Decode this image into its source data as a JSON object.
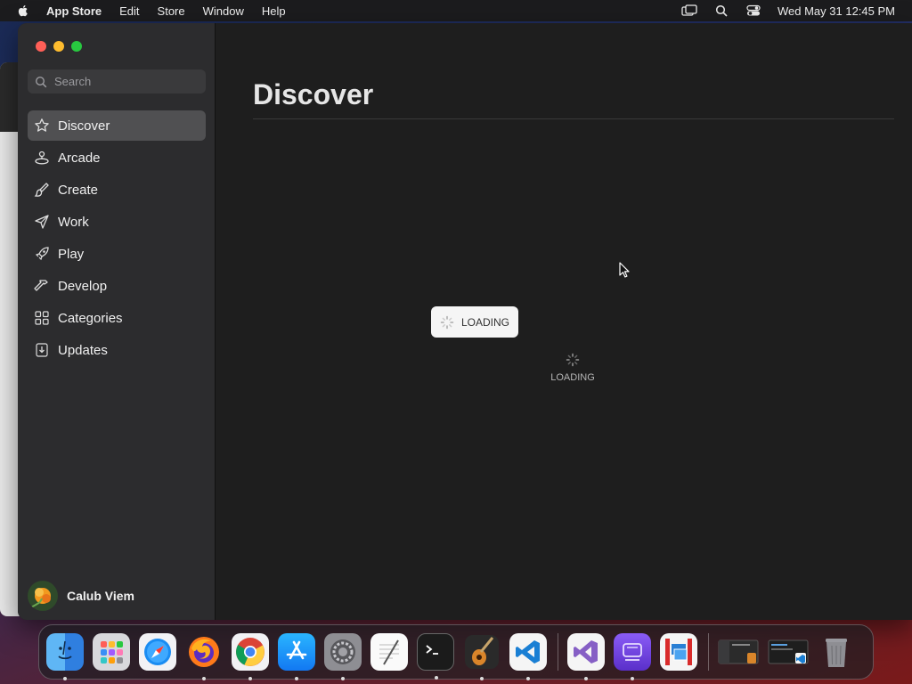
{
  "menubar": {
    "app_name": "App Store",
    "items": [
      "Edit",
      "Store",
      "Window",
      "Help"
    ],
    "clock": "Wed May 31  12:45 PM"
  },
  "sidebar": {
    "search_placeholder": "Search",
    "items": [
      {
        "label": "Discover",
        "icon": "star-icon",
        "active": true
      },
      {
        "label": "Arcade",
        "icon": "joystick-icon"
      },
      {
        "label": "Create",
        "icon": "brush-icon"
      },
      {
        "label": "Work",
        "icon": "paperplane-icon"
      },
      {
        "label": "Play",
        "icon": "rocket-icon"
      },
      {
        "label": "Develop",
        "icon": "hammer-icon"
      },
      {
        "label": "Categories",
        "icon": "grid-icon"
      },
      {
        "label": "Updates",
        "icon": "download-icon"
      }
    ],
    "user_name": "Calub Viem"
  },
  "main": {
    "title": "Discover",
    "loading_pill_label": "LOADING",
    "loading_center_label": "LOADING"
  },
  "dock": {
    "apps": [
      "finder-icon",
      "launchpad-icon",
      "safari-icon",
      "firefox-icon",
      "chrome-icon",
      "app-store-icon",
      "system-settings-icon",
      "textedit-icon",
      "terminal-icon",
      "garageband-icon",
      "vscode-icon",
      "visual-studio-icon",
      "disk-utility-icon",
      "parallels-icon",
      "window-thumbnail-icon",
      "window-thumbnail-icon",
      "trash-icon"
    ]
  }
}
